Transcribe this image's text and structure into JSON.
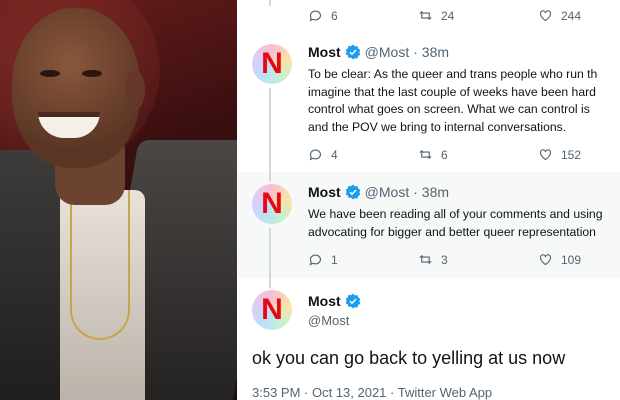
{
  "top_actions": {
    "replies": "6",
    "retweets": "24",
    "likes": "244"
  },
  "tweets": [
    {
      "avatar_letter": "N",
      "name": "Most",
      "handle": "@Most",
      "time": "· 38m",
      "lines": [
        "To be clear: As the queer and trans people who run th",
        "imagine that the last couple of weeks have been hard",
        "control what goes on screen. What we can control is",
        "and the POV we bring to internal conversations."
      ],
      "replies": "4",
      "retweets": "6",
      "likes": "152"
    },
    {
      "avatar_letter": "N",
      "name": "Most",
      "handle": "@Most",
      "time": "· 38m",
      "lines": [
        "We have been reading all of your comments and using",
        "advocating for bigger and better queer representation"
      ],
      "replies": "1",
      "retweets": "3",
      "likes": "109"
    }
  ],
  "main_tweet": {
    "avatar_letter": "N",
    "name": "Most",
    "handle": "@Most",
    "text": "ok you can go back to yelling at us now",
    "footer": "3:53 PM · Oct 13, 2021 · Twitter Web App"
  },
  "colors": {
    "brand_red": "#e50914",
    "verified_blue": "#1d9bf0",
    "muted": "#536471"
  }
}
